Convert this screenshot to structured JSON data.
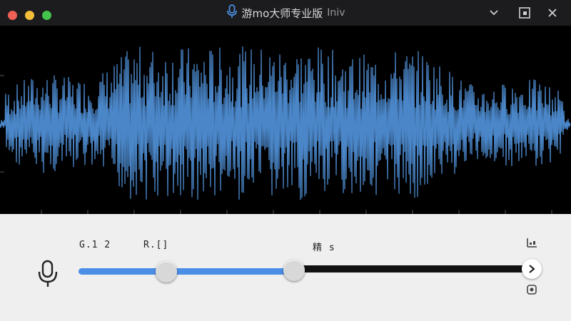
{
  "window": {
    "title": "游mo大师专业版",
    "title_suffix": "Iniv"
  },
  "icons": {
    "title_mic": "microphone-icon",
    "dropdown": "chevron-down-icon",
    "maximize": "window-maximize-icon",
    "close": "close-icon",
    "mic_input": "microphone-icon",
    "next": "chevron-right-icon",
    "top_right": "equalizer-icon",
    "bottom_right": "record-icon"
  },
  "colors": {
    "waveform": "#4a86c8",
    "slider_fill": "#4a8ee6",
    "slider_track": "#111111"
  },
  "controls": {
    "label_left": "G.1 2",
    "label_mid": "R.[]",
    "label_right": "精 s",
    "slider1_value": 0.195,
    "slider2_value": 0.48
  }
}
